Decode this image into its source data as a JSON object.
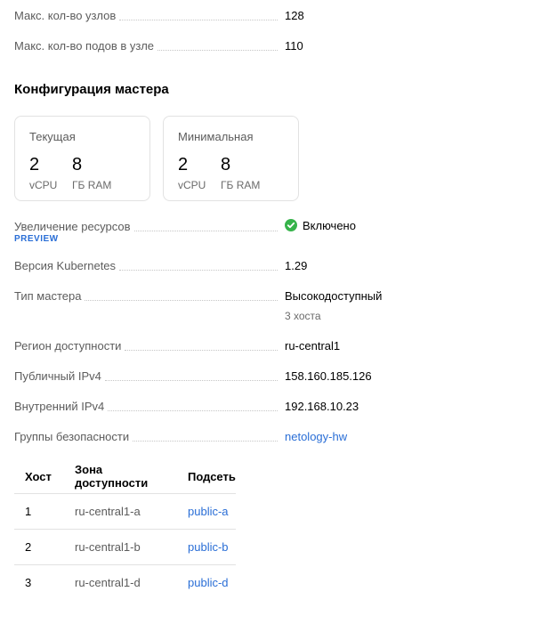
{
  "top_rows": [
    {
      "label": "Макс. кол-во узлов",
      "value": "128"
    },
    {
      "label": "Макс. кол-во подов в узле",
      "value": "110"
    }
  ],
  "master_config": {
    "heading": "Конфигурация мастера",
    "current": {
      "title": "Текущая",
      "vcpu": "2",
      "vcpu_unit": "vCPU",
      "ram": "8",
      "ram_unit": "ГБ RAM"
    },
    "minimal": {
      "title": "Минимальная",
      "vcpu": "2",
      "vcpu_unit": "vCPU",
      "ram": "8",
      "ram_unit": "ГБ RAM"
    }
  },
  "resource_increase": {
    "label": "Увеличение ресурсов",
    "badge": "PREVIEW",
    "value": "Включено",
    "status_icon": "check-circle-icon",
    "status_color": "#36b34a"
  },
  "details": {
    "k8s_version": {
      "label": "Версия Kubernetes",
      "value": "1.29"
    },
    "master_type": {
      "label": "Тип мастера",
      "value": "Высокодоступный",
      "sub": "3 хоста"
    },
    "region": {
      "label": "Регион доступности",
      "value": "ru-central1"
    },
    "public_ip": {
      "label": "Публичный IPv4",
      "value": "158.160.185.126"
    },
    "internal_ip": {
      "label": "Внутренний IPv4",
      "value": "192.168.10.23"
    },
    "security_groups": {
      "label": "Группы безопасности",
      "value": "netology-hw"
    }
  },
  "hosts_table": {
    "headers": {
      "host": "Хост",
      "zone": "Зона доступности",
      "subnet": "Подсеть"
    },
    "rows": [
      {
        "host": "1",
        "zone": "ru-central1-a",
        "subnet": "public-a"
      },
      {
        "host": "2",
        "zone": "ru-central1-b",
        "subnet": "public-b"
      },
      {
        "host": "3",
        "zone": "ru-central1-d",
        "subnet": "public-d"
      }
    ]
  },
  "colors": {
    "link": "#2a6ed6",
    "success": "#36b34a"
  }
}
